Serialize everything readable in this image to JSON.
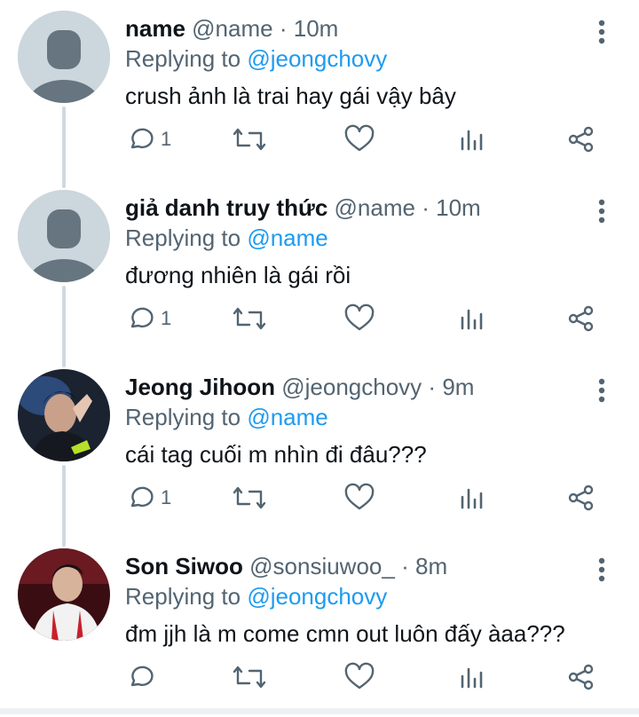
{
  "colors": {
    "accent": "#1d9bf0",
    "muted": "#536471",
    "text": "#0f1419",
    "icon": "#536471",
    "thread": "#cfd9de"
  },
  "tweets": [
    {
      "display_name": "name",
      "handle": "@name",
      "dot": "·",
      "time": "10m",
      "replying_label": "Replying to",
      "replying_to": "@jeongchovy",
      "text": "crush ảnh là trai hay gái vậy bây",
      "reply_count": "1",
      "avatar": "default-avatar"
    },
    {
      "display_name": "giả danh truy thức",
      "handle": "@name",
      "dot": "·",
      "time": "10m",
      "replying_label": "Replying to",
      "replying_to": "@name",
      "text": "đương nhiên là gái rồi",
      "reply_count": "1",
      "avatar": "default-avatar"
    },
    {
      "display_name": "Jeong Jihoon",
      "handle": "@jeongchovy",
      "dot": "·",
      "time": "9m",
      "replying_label": "Replying to",
      "replying_to": "@name",
      "text": "cái tag cuối m nhìn đi đâu???",
      "reply_count": "1",
      "avatar": "photo-avatar"
    },
    {
      "display_name": "Son Siwoo",
      "handle": "@sonsiuwoo_",
      "dot": "·",
      "time": "8m",
      "replying_label": "Replying to",
      "replying_to": "@jeongchovy",
      "text": "đm jjh là m come cmn out luôn đấy àaa???",
      "reply_count": "",
      "avatar": "photo-avatar"
    }
  ]
}
